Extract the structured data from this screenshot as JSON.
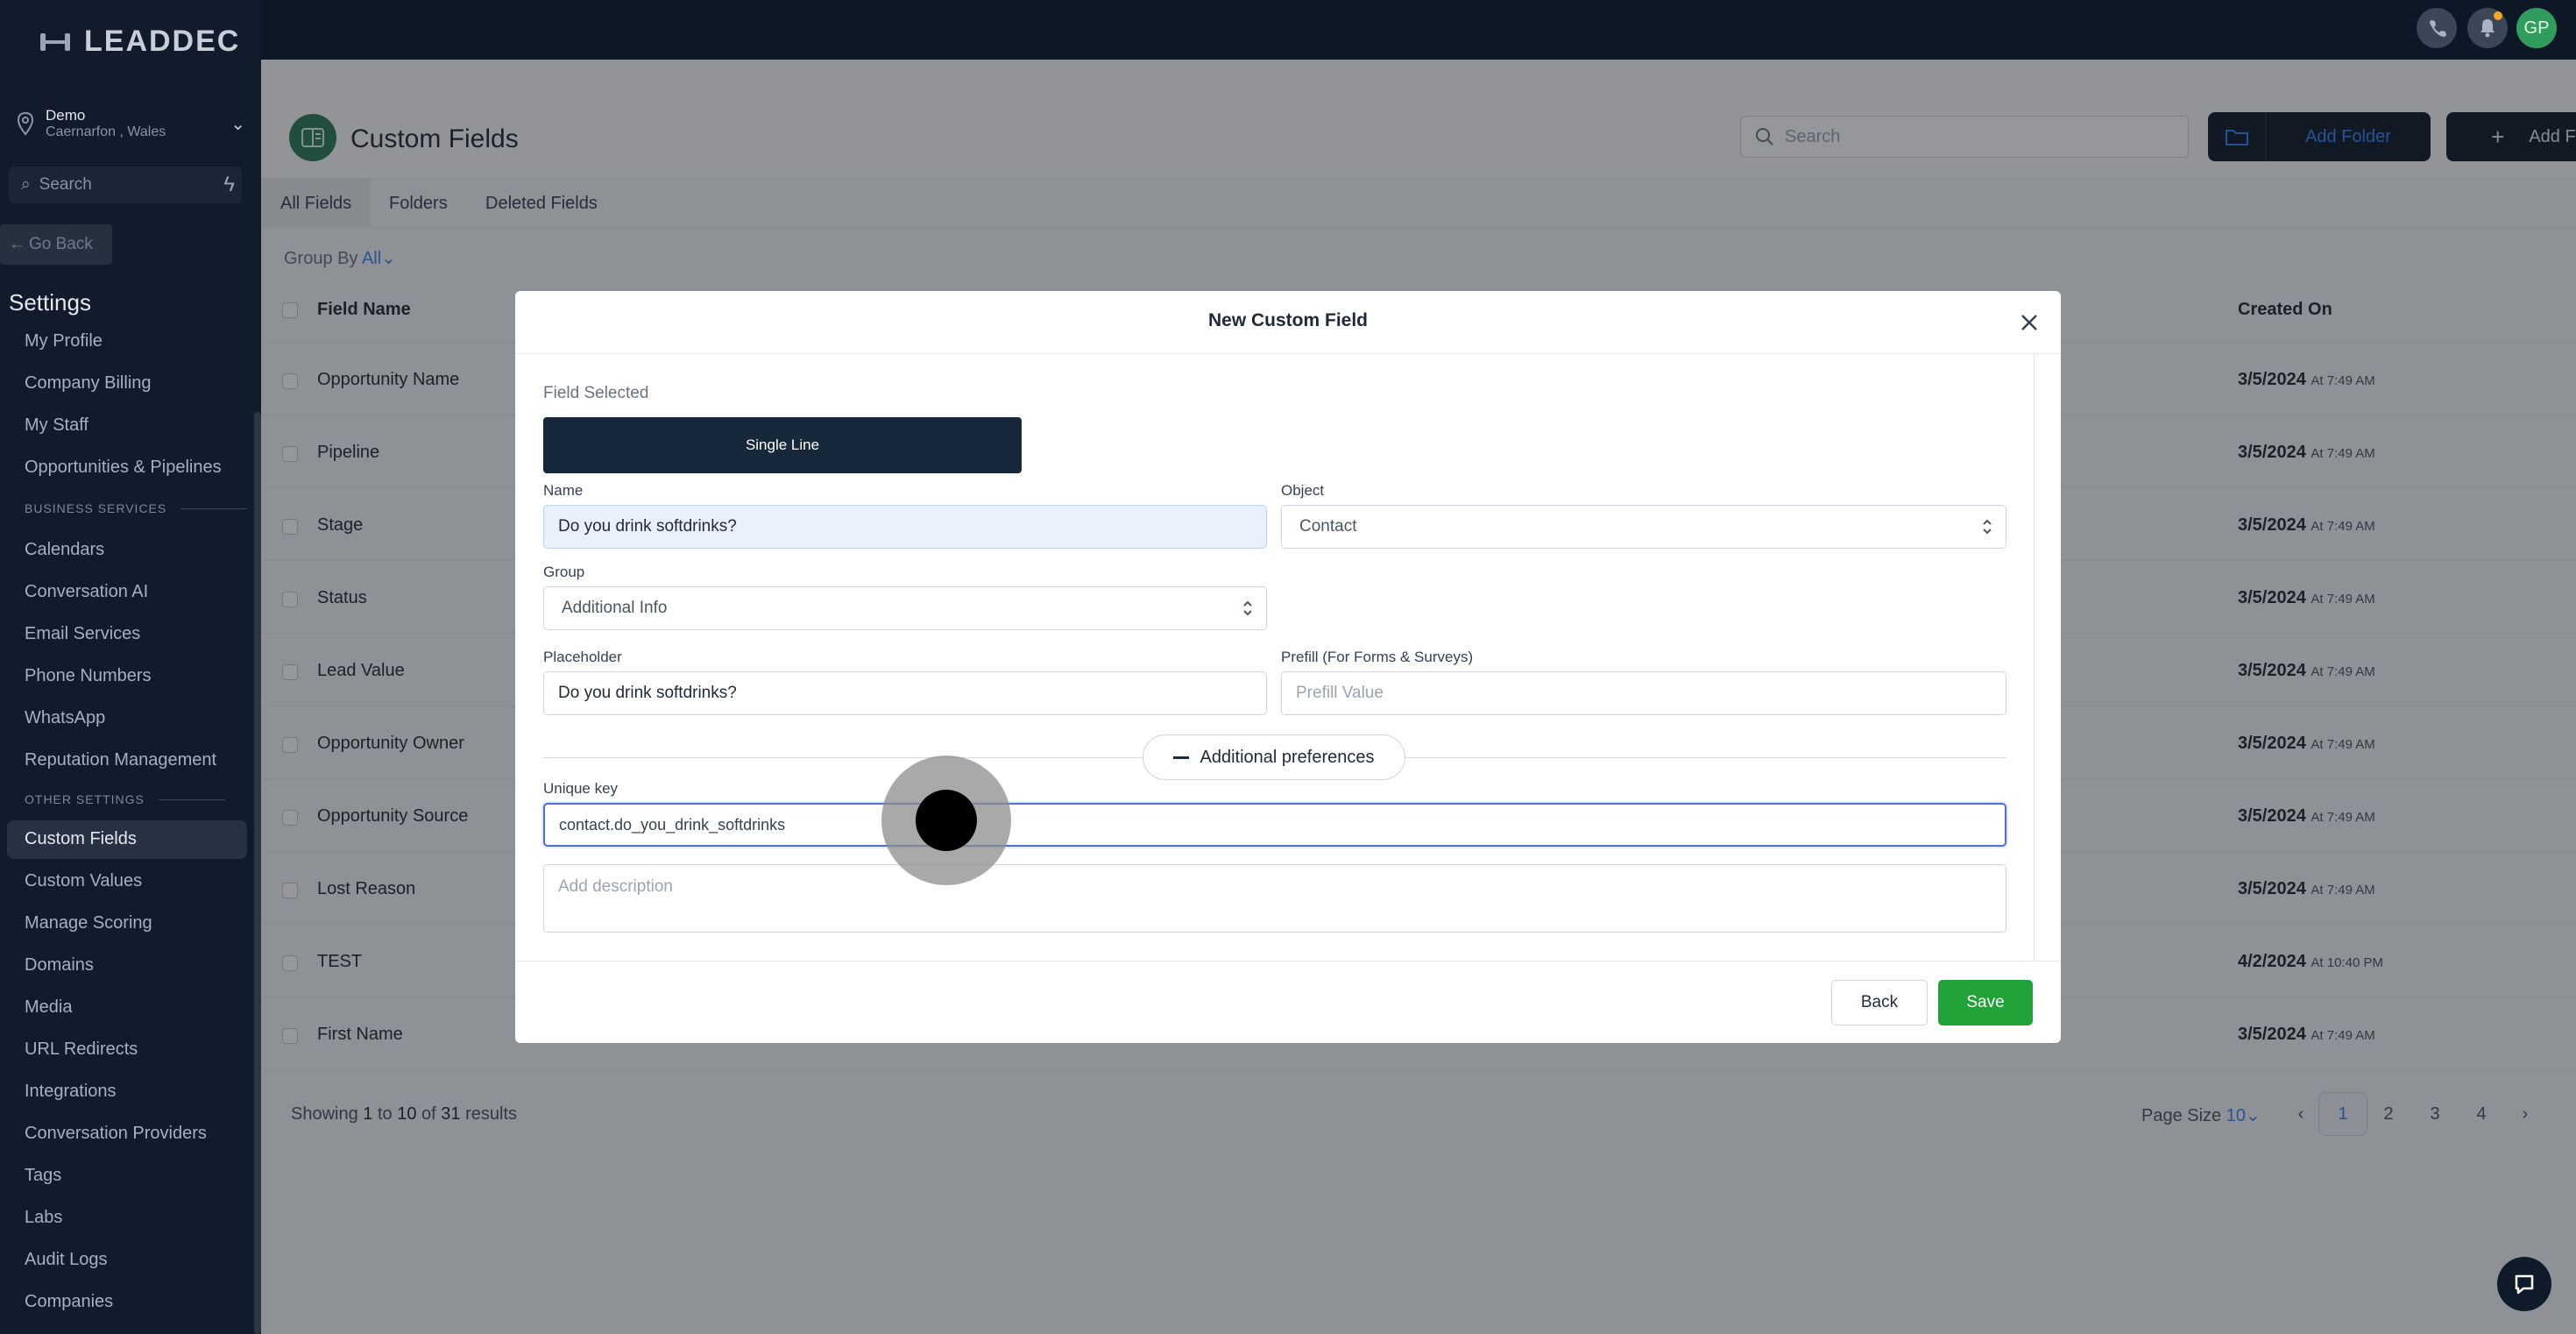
{
  "brand": {
    "name": "LEADDEC"
  },
  "location": {
    "name": "Demo",
    "subtitle": "Caernarfon , Wales"
  },
  "sidebar": {
    "search_placeholder": "Search",
    "go_back": "Go Back",
    "settings_title": "Settings",
    "items_top": [
      "My Profile",
      "Company Billing",
      "My Staff",
      "Opportunities & Pipelines"
    ],
    "section_business": "BUSINESS SERVICES",
    "items_business": [
      "Calendars",
      "Conversation AI",
      "Email Services",
      "Phone Numbers",
      "WhatsApp",
      "Reputation Management"
    ],
    "section_other": "OTHER SETTINGS",
    "items_other": [
      "Custom Fields",
      "Custom Values",
      "Manage Scoring",
      "Domains",
      "Media",
      "URL Redirects",
      "Integrations",
      "Conversation Providers",
      "Tags",
      "Labs",
      "Audit Logs",
      "Companies"
    ]
  },
  "topbar": {
    "avatar_initials": "GP"
  },
  "page": {
    "title": "Custom Fields",
    "search_placeholder": "Search",
    "add_folder": "Add Folder",
    "add_field": "Add Field",
    "tabs": [
      "All Fields",
      "Folders",
      "Deleted Fields"
    ],
    "group_by_label": "Group By",
    "group_by_value": "All",
    "columns": {
      "field_name": "Field Name",
      "created_on": "Created On"
    },
    "rows": [
      {
        "name": "Opportunity Name",
        "date": "3/5/2024",
        "time": "At 7:49 AM"
      },
      {
        "name": "Pipeline",
        "date": "3/5/2024",
        "time": "At 7:49 AM"
      },
      {
        "name": "Stage",
        "date": "3/5/2024",
        "time": "At 7:49 AM"
      },
      {
        "name": "Status",
        "date": "3/5/2024",
        "time": "At 7:49 AM"
      },
      {
        "name": "Lead Value",
        "date": "3/5/2024",
        "time": "At 7:49 AM"
      },
      {
        "name": "Opportunity Owner",
        "date": "3/5/2024",
        "time": "At 7:49 AM"
      },
      {
        "name": "Opportunity Source",
        "date": "3/5/2024",
        "time": "At 7:49 AM"
      },
      {
        "name": "Lost Reason",
        "date": "3/5/2024",
        "time": "At 7:49 AM"
      },
      {
        "name": "TEST",
        "date": "4/2/2024",
        "time": "At 10:40 PM"
      },
      {
        "name": "First Name",
        "date": "3/5/2024",
        "time": "At 7:49 AM"
      }
    ],
    "showing": {
      "prefix": "Showing",
      "from": "1",
      "to_word": "to",
      "to": "10",
      "of_word": "of",
      "total": "31",
      "suffix": "results"
    },
    "page_size_label": "Page Size",
    "page_size_value": "10",
    "pages": [
      "1",
      "2",
      "3",
      "4"
    ]
  },
  "modal": {
    "title": "New Custom Field",
    "field_selected_label": "Field Selected",
    "field_selected_value": "Single Line",
    "name_label": "Name",
    "name_value": "Do you drink softdrinks?",
    "object_label": "Object",
    "object_value": "Contact",
    "group_label": "Group",
    "group_value": "Additional Info",
    "placeholder_label": "Placeholder",
    "placeholder_value": "Do you drink softdrinks?",
    "prefill_label": "Prefill (For Forms & Surveys)",
    "prefill_placeholder": "Prefill Value",
    "additional_prefs": "Additional preferences",
    "unique_key_label": "Unique key",
    "unique_key_value": "contact.do_you_drink_softdrinks",
    "description_placeholder": "Add description",
    "back_button": "Back",
    "save_button": "Save"
  }
}
